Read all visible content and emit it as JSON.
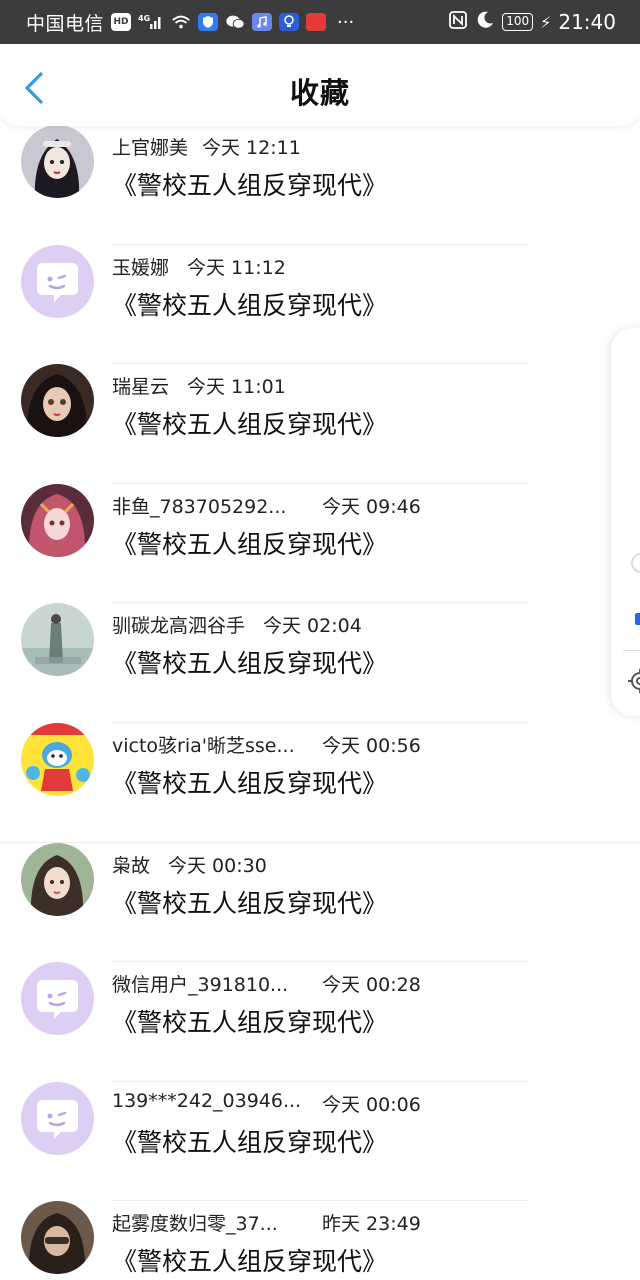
{
  "status_bar": {
    "carrier": "中国电信",
    "hd_badge": "HD",
    "network": "4G",
    "battery": "100",
    "time": "21:40"
  },
  "header": {
    "title": "收藏",
    "back_icon": "chevron-left-icon",
    "accent_color": "#2f9be8"
  },
  "favorites": [
    {
      "name": "上官娜美",
      "time": "今天 12:11",
      "book": "《警校五人组反穿现代》",
      "avatar": "photo"
    },
    {
      "name": "玉媛娜",
      "time": "今天 11:12",
      "book": "《警校五人组反穿现代》",
      "avatar": "default"
    },
    {
      "name": "瑞星云",
      "time": "今天 11:01",
      "book": "《警校五人组反穿现代》",
      "avatar": "photo"
    },
    {
      "name": "非鱼_783705292...",
      "time": "今天 09:46",
      "book": "《警校五人组反穿现代》",
      "avatar": "photo"
    },
    {
      "name": "驯碳龙高泗谷手",
      "time": "今天 02:04",
      "book": "《警校五人组反穿现代》",
      "avatar": "photo"
    },
    {
      "name": "victo骇ria'晰芝sse...",
      "time": "今天 00:56",
      "book": "《警校五人组反穿现代》",
      "avatar": "photo"
    },
    {
      "name": "枭故",
      "time": "今天 00:30",
      "book": "《警校五人组反穿现代》",
      "avatar": "photo"
    },
    {
      "name": "微信用户_391810...",
      "time": "今天 00:28",
      "book": "《警校五人组反穿现代》",
      "avatar": "default"
    },
    {
      "name": "139***242_03946...",
      "time": "今天 00:06",
      "book": "《警校五人组反穿现代》",
      "avatar": "default"
    },
    {
      "name": "起雾度数归零_37...",
      "time": "昨天 23:49",
      "book": "《警校五人组反穿现代》",
      "avatar": "photo"
    }
  ]
}
